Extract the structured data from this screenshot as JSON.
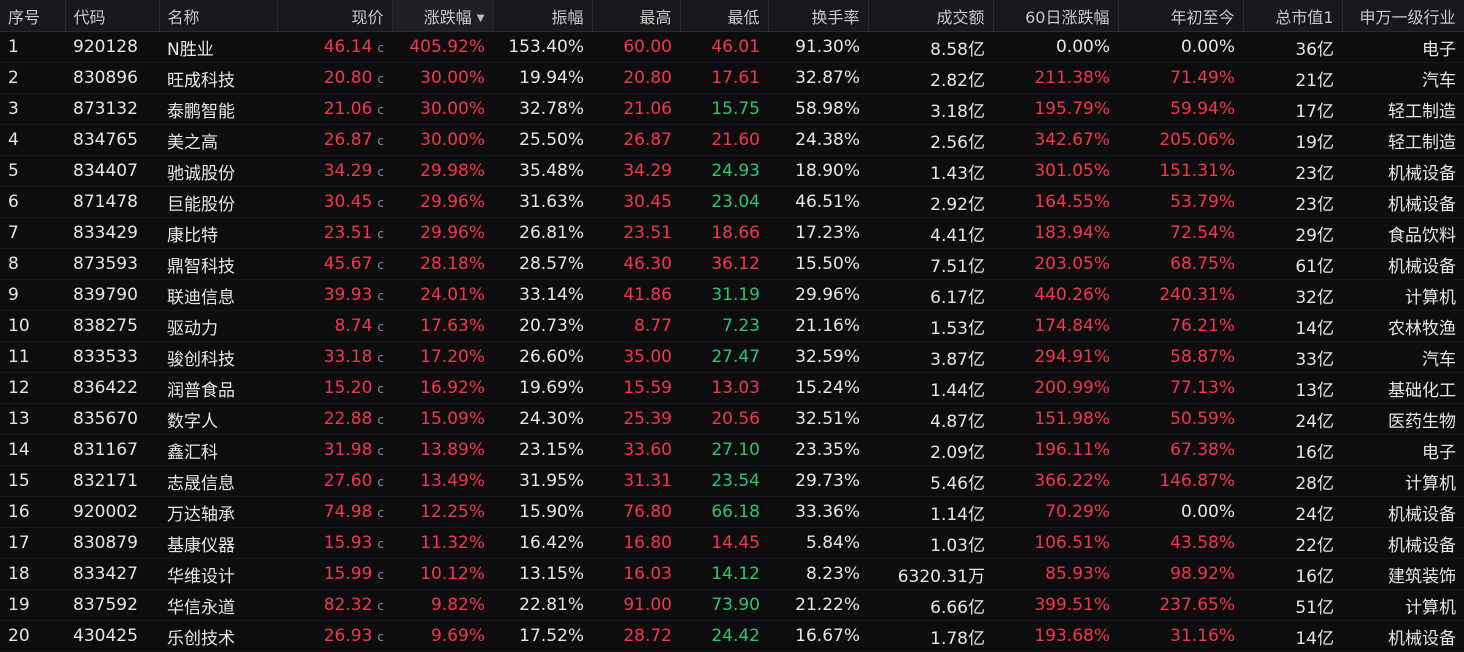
{
  "headers": {
    "seq": "序号",
    "code": "代码",
    "name": "名称",
    "price": "现价",
    "change_pct": "涨跌幅",
    "amplitude": "振幅",
    "high": "最高",
    "low": "最低",
    "turnover": "换手率",
    "volume_amt": "成交额",
    "chg60": "60日涨跌幅",
    "ytd": "年初至今",
    "mktcap": "总市值1",
    "industry": "申万一级行业"
  },
  "sort_icon": "sort-desc-icon",
  "price_flag": "c",
  "rows": [
    [
      "1",
      "920128",
      "N胜业",
      "46.14",
      "405.92%",
      "153.40%",
      "60.00",
      "46.01",
      "91.30%",
      "8.58亿",
      "0.00%",
      "0.00%",
      "36亿",
      "电子"
    ],
    [
      "2",
      "830896",
      "旺成科技",
      "20.80",
      "30.00%",
      "19.94%",
      "20.80",
      "17.61",
      "32.87%",
      "2.82亿",
      "211.38%",
      "71.49%",
      "21亿",
      "汽车"
    ],
    [
      "3",
      "873132",
      "泰鹏智能",
      "21.06",
      "30.00%",
      "32.78%",
      "21.06",
      "15.75",
      "58.98%",
      "3.18亿",
      "195.79%",
      "59.94%",
      "17亿",
      "轻工制造"
    ],
    [
      "4",
      "834765",
      "美之高",
      "26.87",
      "30.00%",
      "25.50%",
      "26.87",
      "21.60",
      "24.38%",
      "2.56亿",
      "342.67%",
      "205.06%",
      "19亿",
      "轻工制造"
    ],
    [
      "5",
      "834407",
      "驰诚股份",
      "34.29",
      "29.98%",
      "35.48%",
      "34.29",
      "24.93",
      "18.90%",
      "1.43亿",
      "301.05%",
      "151.31%",
      "23亿",
      "机械设备"
    ],
    [
      "6",
      "871478",
      "巨能股份",
      "30.45",
      "29.96%",
      "31.63%",
      "30.45",
      "23.04",
      "46.51%",
      "2.92亿",
      "164.55%",
      "53.79%",
      "23亿",
      "机械设备"
    ],
    [
      "7",
      "833429",
      "康比特",
      "23.51",
      "29.96%",
      "26.81%",
      "23.51",
      "18.66",
      "17.23%",
      "4.41亿",
      "183.94%",
      "72.54%",
      "29亿",
      "食品饮料"
    ],
    [
      "8",
      "873593",
      "鼎智科技",
      "45.67",
      "28.18%",
      "28.57%",
      "46.30",
      "36.12",
      "15.50%",
      "7.51亿",
      "203.05%",
      "68.75%",
      "61亿",
      "机械设备"
    ],
    [
      "9",
      "839790",
      "联迪信息",
      "39.93",
      "24.01%",
      "33.14%",
      "41.86",
      "31.19",
      "29.96%",
      "6.17亿",
      "440.26%",
      "240.31%",
      "32亿",
      "计算机"
    ],
    [
      "10",
      "838275",
      "驱动力",
      "8.74",
      "17.63%",
      "20.73%",
      "8.77",
      "7.23",
      "21.16%",
      "1.53亿",
      "174.84%",
      "76.21%",
      "14亿",
      "农林牧渔"
    ],
    [
      "11",
      "833533",
      "骏创科技",
      "33.18",
      "17.20%",
      "26.60%",
      "35.00",
      "27.47",
      "32.59%",
      "3.87亿",
      "294.91%",
      "58.87%",
      "33亿",
      "汽车"
    ],
    [
      "12",
      "836422",
      "润普食品",
      "15.20",
      "16.92%",
      "19.69%",
      "15.59",
      "13.03",
      "15.24%",
      "1.44亿",
      "200.99%",
      "77.13%",
      "13亿",
      "基础化工"
    ],
    [
      "13",
      "835670",
      "数字人",
      "22.88",
      "15.09%",
      "24.30%",
      "25.39",
      "20.56",
      "32.51%",
      "4.87亿",
      "151.98%",
      "50.59%",
      "24亿",
      "医药生物"
    ],
    [
      "14",
      "831167",
      "鑫汇科",
      "31.98",
      "13.89%",
      "23.15%",
      "33.60",
      "27.10",
      "23.35%",
      "2.09亿",
      "196.11%",
      "67.38%",
      "16亿",
      "电子"
    ],
    [
      "15",
      "832171",
      "志晟信息",
      "27.60",
      "13.49%",
      "31.95%",
      "31.31",
      "23.54",
      "29.73%",
      "5.46亿",
      "366.22%",
      "146.87%",
      "28亿",
      "计算机"
    ],
    [
      "16",
      "920002",
      "万达轴承",
      "74.98",
      "12.25%",
      "15.90%",
      "76.80",
      "66.18",
      "33.36%",
      "1.14亿",
      "70.29%",
      "0.00%",
      "24亿",
      "机械设备"
    ],
    [
      "17",
      "830879",
      "基康仪器",
      "15.93",
      "11.32%",
      "16.42%",
      "16.80",
      "14.45",
      "5.84%",
      "1.03亿",
      "106.51%",
      "43.58%",
      "22亿",
      "机械设备"
    ],
    [
      "18",
      "833427",
      "华维设计",
      "15.99",
      "10.12%",
      "13.15%",
      "16.03",
      "14.12",
      "8.23%",
      "6320.31万",
      "85.93%",
      "98.92%",
      "16亿",
      "建筑装饰"
    ],
    [
      "19",
      "837592",
      "华信永道",
      "82.32",
      "9.82%",
      "22.81%",
      "91.00",
      "73.90",
      "21.22%",
      "6.66亿",
      "399.51%",
      "237.65%",
      "51亿",
      "计算机"
    ],
    [
      "20",
      "430425",
      "乐创技术",
      "26.93",
      "9.69%",
      "17.52%",
      "28.72",
      "24.42",
      "16.67%",
      "1.78亿",
      "193.68%",
      "31.16%",
      "14亿",
      "机械设备"
    ]
  ],
  "colors": {
    "up": "#f2374b",
    "down": "#29c76b",
    "flat": "#e6e6e6",
    "background": "#0d0d10",
    "header_bg": "#17171c"
  }
}
